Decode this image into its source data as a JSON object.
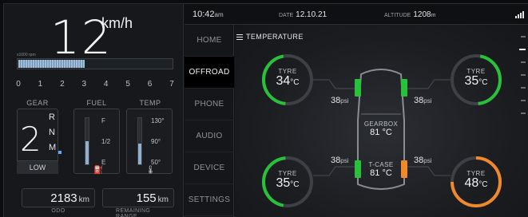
{
  "cluster": {
    "speed": "12",
    "speed_unit": "km/h",
    "rpm_caption": "x1000 rpm",
    "rpm_level": 0.43,
    "rpm_ticks": [
      "0",
      "1",
      "2",
      "3",
      "4",
      "5",
      "6",
      "7"
    ],
    "gear": {
      "label": "GEAR",
      "current": "2",
      "options": [
        "R",
        "N",
        "M"
      ],
      "mode": "LOW"
    },
    "fuel": {
      "label": "FUEL",
      "scale": [
        "F",
        "1/2",
        "E"
      ],
      "level": 0.5
    },
    "temp": {
      "label": "TEMP",
      "scale": [
        "130°",
        "90°",
        "50°"
      ],
      "level": 0.45
    },
    "odo": {
      "value": "2183",
      "unit": "km",
      "label": "ODO"
    },
    "range": {
      "value": "155",
      "unit": "km",
      "label": "REMAINING RANGE"
    }
  },
  "status": {
    "time": "10:42",
    "time_suffix": "am",
    "date_caption": "DATE",
    "date": "12.10.21",
    "altitude_caption": "ALTITUDE",
    "altitude": "1208",
    "altitude_unit": "m",
    "icons": {
      "signal": "signal-strength-icon"
    }
  },
  "menu": {
    "items": [
      {
        "label": "HOME"
      },
      {
        "label": "OFFROAD",
        "active": true
      },
      {
        "label": "PHONE"
      },
      {
        "label": "AUDIO"
      },
      {
        "label": "DEVICE"
      },
      {
        "label": "SETTINGS"
      }
    ]
  },
  "panel": {
    "title": "TEMPERATURE",
    "tyres": {
      "front_left": {
        "caption": "TYRE",
        "temp": "34",
        "unit": "°C",
        "psi": "38",
        "psi_unit": "psi",
        "color": "#27c23a"
      },
      "front_right": {
        "caption": "TYRE",
        "temp": "35",
        "unit": "°C",
        "psi": "38",
        "psi_unit": "psi",
        "color": "#27c23a"
      },
      "rear_left": {
        "caption": "TYRE",
        "temp": "35",
        "unit": "°C",
        "psi": "38",
        "psi_unit": "psi",
        "color": "#27c23a"
      },
      "rear_right": {
        "caption": "TYRE",
        "temp": "48",
        "unit": "°C",
        "psi": "38",
        "psi_unit": "psi",
        "color": "#f0892a"
      }
    },
    "gearbox": {
      "caption": "GEARBOX",
      "value": "81 °C"
    },
    "tcase": {
      "caption": "T-CASE",
      "value": "81 °C"
    }
  }
}
